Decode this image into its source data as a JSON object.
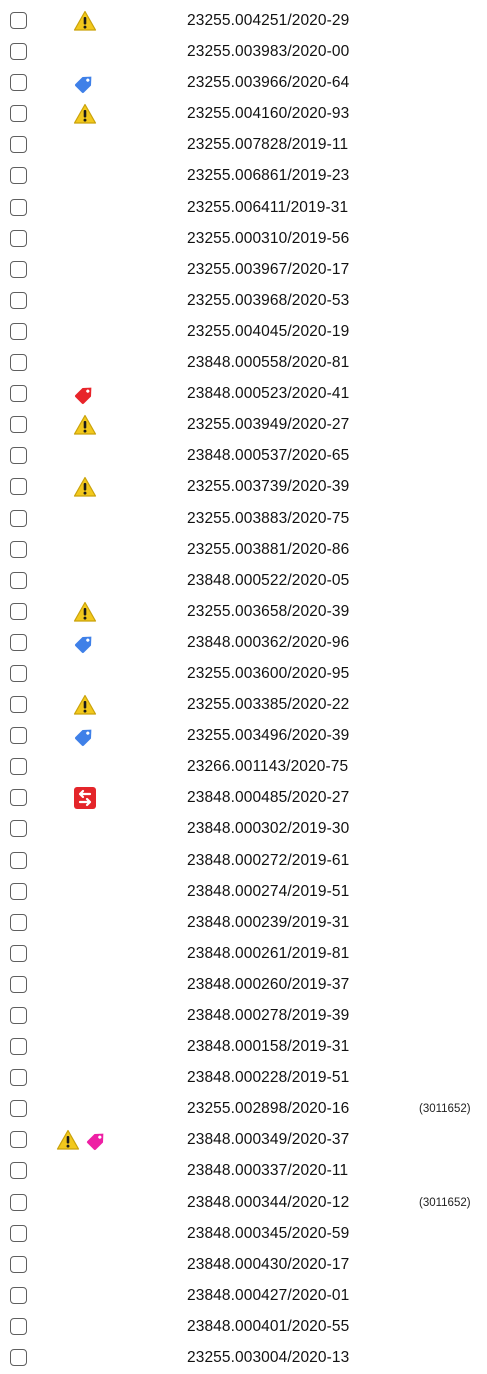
{
  "rows": [
    {
      "id": "23255.004251/2020-29",
      "icons": [
        "warning-icon"
      ],
      "note": ""
    },
    {
      "id": "23255.003983/2020-00",
      "icons": [],
      "note": ""
    },
    {
      "id": "23255.003966/2020-64",
      "icons": [
        "blue-tag-icon"
      ],
      "note": ""
    },
    {
      "id": "23255.004160/2020-93",
      "icons": [
        "warning-icon"
      ],
      "note": ""
    },
    {
      "id": "23255.007828/2019-11",
      "icons": [],
      "note": ""
    },
    {
      "id": "23255.006861/2019-23",
      "icons": [],
      "note": ""
    },
    {
      "id": "23255.006411/2019-31",
      "icons": [],
      "note": ""
    },
    {
      "id": "23255.000310/2019-56",
      "icons": [],
      "note": ""
    },
    {
      "id": "23255.003967/2020-17",
      "icons": [],
      "note": ""
    },
    {
      "id": "23255.003968/2020-53",
      "icons": [],
      "note": ""
    },
    {
      "id": "23255.004045/2020-19",
      "icons": [],
      "note": ""
    },
    {
      "id": "23848.000558/2020-81",
      "icons": [],
      "note": ""
    },
    {
      "id": "23848.000523/2020-41",
      "icons": [
        "red-tag-icon"
      ],
      "note": ""
    },
    {
      "id": "23255.003949/2020-27",
      "icons": [
        "warning-icon"
      ],
      "note": ""
    },
    {
      "id": "23848.000537/2020-65",
      "icons": [],
      "note": ""
    },
    {
      "id": "23255.003739/2020-39",
      "icons": [
        "warning-icon"
      ],
      "note": ""
    },
    {
      "id": "23255.003883/2020-75",
      "icons": [],
      "note": ""
    },
    {
      "id": "23255.003881/2020-86",
      "icons": [],
      "note": ""
    },
    {
      "id": "23848.000522/2020-05",
      "icons": [],
      "note": ""
    },
    {
      "id": "23255.003658/2020-39",
      "icons": [
        "warning-icon"
      ],
      "note": ""
    },
    {
      "id": "23848.000362/2020-96",
      "icons": [
        "blue-tag-icon"
      ],
      "note": ""
    },
    {
      "id": "23255.003600/2020-95",
      "icons": [],
      "note": ""
    },
    {
      "id": "23255.003385/2020-22",
      "icons": [
        "warning-icon"
      ],
      "note": ""
    },
    {
      "id": "23255.003496/2020-39",
      "icons": [
        "blue-tag-icon"
      ],
      "note": ""
    },
    {
      "id": "23266.001143/2020-75",
      "icons": [],
      "note": ""
    },
    {
      "id": "23848.000485/2020-27",
      "icons": [
        "transfer-icon"
      ],
      "note": ""
    },
    {
      "id": "23848.000302/2019-30",
      "icons": [],
      "note": ""
    },
    {
      "id": "23848.000272/2019-61",
      "icons": [],
      "note": ""
    },
    {
      "id": "23848.000274/2019-51",
      "icons": [],
      "note": ""
    },
    {
      "id": "23848.000239/2019-31",
      "icons": [],
      "note": ""
    },
    {
      "id": "23848.000261/2019-81",
      "icons": [],
      "note": ""
    },
    {
      "id": "23848.000260/2019-37",
      "icons": [],
      "note": ""
    },
    {
      "id": "23848.000278/2019-39",
      "icons": [],
      "note": ""
    },
    {
      "id": "23848.000158/2019-31",
      "icons": [],
      "note": ""
    },
    {
      "id": "23848.000228/2019-51",
      "icons": [],
      "note": ""
    },
    {
      "id": "23255.002898/2020-16",
      "icons": [],
      "note": "(3011652)"
    },
    {
      "id": "23848.000349/2020-37",
      "icons": [
        "warning-icon",
        "pink-tag-icon"
      ],
      "note": ""
    },
    {
      "id": "23848.000337/2020-11",
      "icons": [],
      "note": ""
    },
    {
      "id": "23848.000344/2020-12",
      "icons": [],
      "note": "(3011652)"
    },
    {
      "id": "23848.000345/2020-59",
      "icons": [],
      "note": ""
    },
    {
      "id": "23848.000430/2020-17",
      "icons": [],
      "note": ""
    },
    {
      "id": "23848.000427/2020-01",
      "icons": [],
      "note": ""
    },
    {
      "id": "23848.000401/2020-55",
      "icons": [],
      "note": ""
    },
    {
      "id": "23255.003004/2020-13",
      "icons": [],
      "note": ""
    }
  ],
  "colors": {
    "warning": "#f2c81c",
    "blue_tag": "#3f80e8",
    "red_tag": "#e8242a",
    "pink_tag": "#ee1fa4",
    "transfer": "#e4252a"
  }
}
